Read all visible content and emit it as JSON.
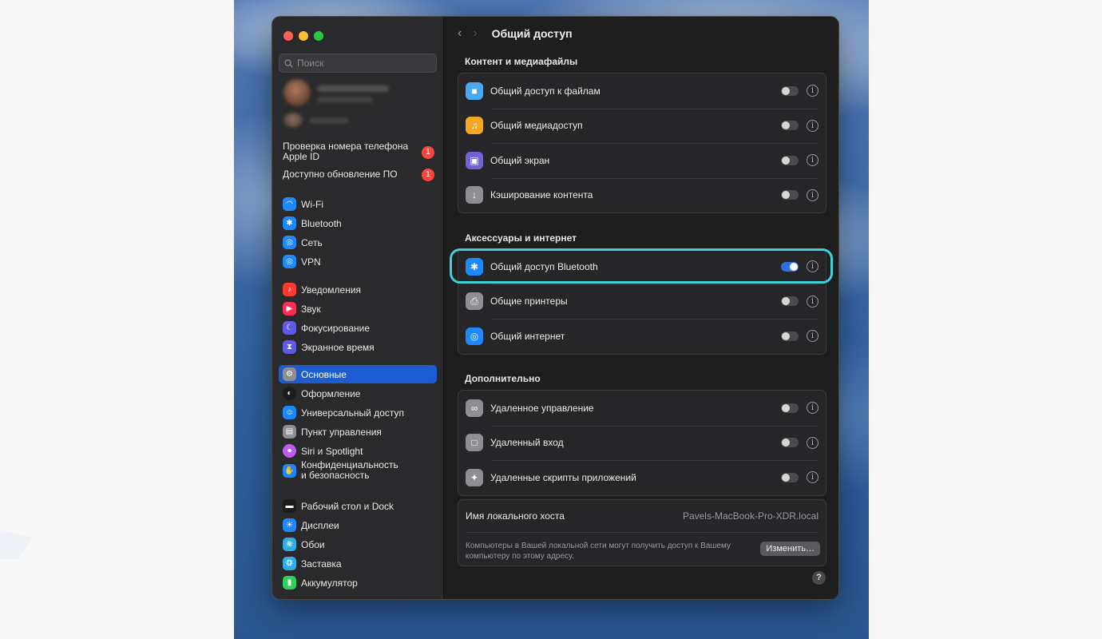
{
  "search": {
    "placeholder": "Поиск"
  },
  "notices": [
    {
      "label": "Проверка номера телефона Apple ID",
      "badge": "1"
    },
    {
      "label": "Доступно обновление ПО",
      "badge": "1"
    }
  ],
  "sidebar": {
    "items": [
      {
        "label": "Wi‑Fi",
        "icon": "wifi-icon",
        "color": "#1e88ff"
      },
      {
        "label": "Bluetooth",
        "icon": "bluetooth-icon",
        "color": "#1e88ff"
      },
      {
        "label": "Сеть",
        "icon": "globe-icon",
        "color": "#1e88ff"
      },
      {
        "label": "VPN",
        "icon": "vpn-icon",
        "color": "#1e88ff"
      },
      {
        "label": "Уведомления",
        "icon": "bell-icon",
        "color": "#ff3b30"
      },
      {
        "label": "Звук",
        "icon": "speaker-icon",
        "color": "#ff2d55"
      },
      {
        "label": "Фокусирование",
        "icon": "moon-icon",
        "color": "#5e5ce6"
      },
      {
        "label": "Экранное время",
        "icon": "hourglass-icon",
        "color": "#5e5ce6"
      },
      {
        "label": "Основные",
        "icon": "gear-icon",
        "color": "#8e8e93",
        "active": true
      },
      {
        "label": "Оформление",
        "icon": "appearance-icon",
        "color": "#1c1c1e"
      },
      {
        "label": "Универсальный доступ",
        "icon": "accessibility-icon",
        "color": "#1e88ff"
      },
      {
        "label": "Пункт управления",
        "icon": "control-center-icon",
        "color": "#8e8e93"
      },
      {
        "label": "Siri и Spotlight",
        "icon": "siri-icon",
        "color": "#bf5af2"
      },
      {
        "label": "Конфиденциальность и безопасность",
        "icon": "hand-icon",
        "color": "#1e88ff"
      },
      {
        "label": "Рабочий стол и Dock",
        "icon": "dock-icon",
        "color": "#1c1c1e"
      },
      {
        "label": "Дисплеи",
        "icon": "sun-icon",
        "color": "#1e88ff"
      },
      {
        "label": "Обои",
        "icon": "wallpaper-icon",
        "color": "#32ade6"
      },
      {
        "label": "Заставка",
        "icon": "screensaver-icon",
        "color": "#32ade6"
      },
      {
        "label": "Аккумулятор",
        "icon": "battery-icon",
        "color": "#30d158"
      }
    ]
  },
  "header": {
    "title": "Общий доступ",
    "back_icon": "chevron-left-icon",
    "forward_icon": "chevron-right-icon"
  },
  "sections": [
    {
      "title": "Контент и медиафайлы",
      "rows": [
        {
          "label": "Общий доступ к файлам",
          "icon": "folder-icon",
          "color": "#4aa8f0",
          "on": false
        },
        {
          "label": "Общий медиадоступ",
          "icon": "music-icon",
          "color": "#f5a623",
          "on": false
        },
        {
          "label": "Общий экран",
          "icon": "screen-share-icon",
          "color": "#6e64d8",
          "on": false
        },
        {
          "label": "Кэширование контента",
          "icon": "download-icon",
          "color": "#8e8e93",
          "on": false
        }
      ]
    },
    {
      "title": "Аксессуары и интернет",
      "rows": [
        {
          "label": "Общий доступ Bluetooth",
          "icon": "bluetooth-icon",
          "color": "#1e88ff",
          "on": true
        },
        {
          "label": "Общие принтеры",
          "icon": "printer-icon",
          "color": "#8e8e93",
          "on": false
        },
        {
          "label": "Общий интернет",
          "icon": "globe-icon",
          "color": "#1e88ff",
          "on": false
        }
      ]
    },
    {
      "title": "Дополнительно",
      "rows": [
        {
          "label": "Удаленное управление",
          "icon": "binoculars-icon",
          "color": "#8e8e93",
          "on": false
        },
        {
          "label": "Удаленный вход",
          "icon": "terminal-icon",
          "color": "#8e8e93",
          "on": false
        },
        {
          "label": "Удаленные скрипты приложений",
          "icon": "script-icon",
          "color": "#8e8e93",
          "on": false
        }
      ]
    }
  ],
  "host": {
    "label": "Имя локального хоста",
    "value": "Pavels-MacBook-Pro-XDR.local",
    "description": "Компьютеры в Вашей локальной сети могут получить доступ к Вашему компьютеру по этому адресу.",
    "edit_label": "Изменить…"
  },
  "help_label": "?",
  "info_glyph": "i",
  "highlight_color": "#3fd2d8",
  "accent_color": "#1c5bd0"
}
